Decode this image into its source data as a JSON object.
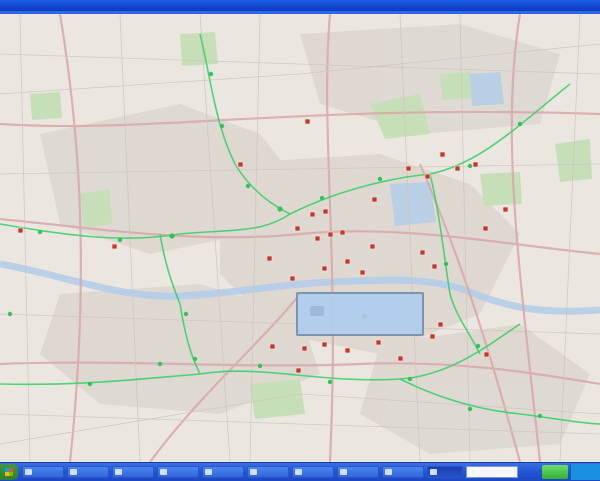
{
  "window": {
    "title": "",
    "accent_color": "#1140c8"
  },
  "map": {
    "water_color": "#a9c6e8",
    "park_color": "#c7dfb9",
    "marker_color": "#c0392b",
    "route_color": "#3cd16b",
    "popup": {
      "icon": "map-label-icon",
      "text": ""
    }
  },
  "taskbar": {
    "start_icon": "windows-flag-icon",
    "buttons": [
      {
        "label": "",
        "icon": "window-icon"
      },
      {
        "label": "",
        "icon": "window-icon"
      },
      {
        "label": "",
        "icon": "window-icon"
      },
      {
        "label": "",
        "icon": "window-icon"
      },
      {
        "label": "",
        "icon": "window-icon"
      },
      {
        "label": "",
        "icon": "window-icon"
      },
      {
        "label": "",
        "icon": "window-icon"
      },
      {
        "label": "",
        "icon": "window-icon"
      },
      {
        "label": "",
        "icon": "window-icon"
      },
      {
        "label": "",
        "icon": "window-icon"
      }
    ],
    "search_value": "",
    "clock": ""
  }
}
